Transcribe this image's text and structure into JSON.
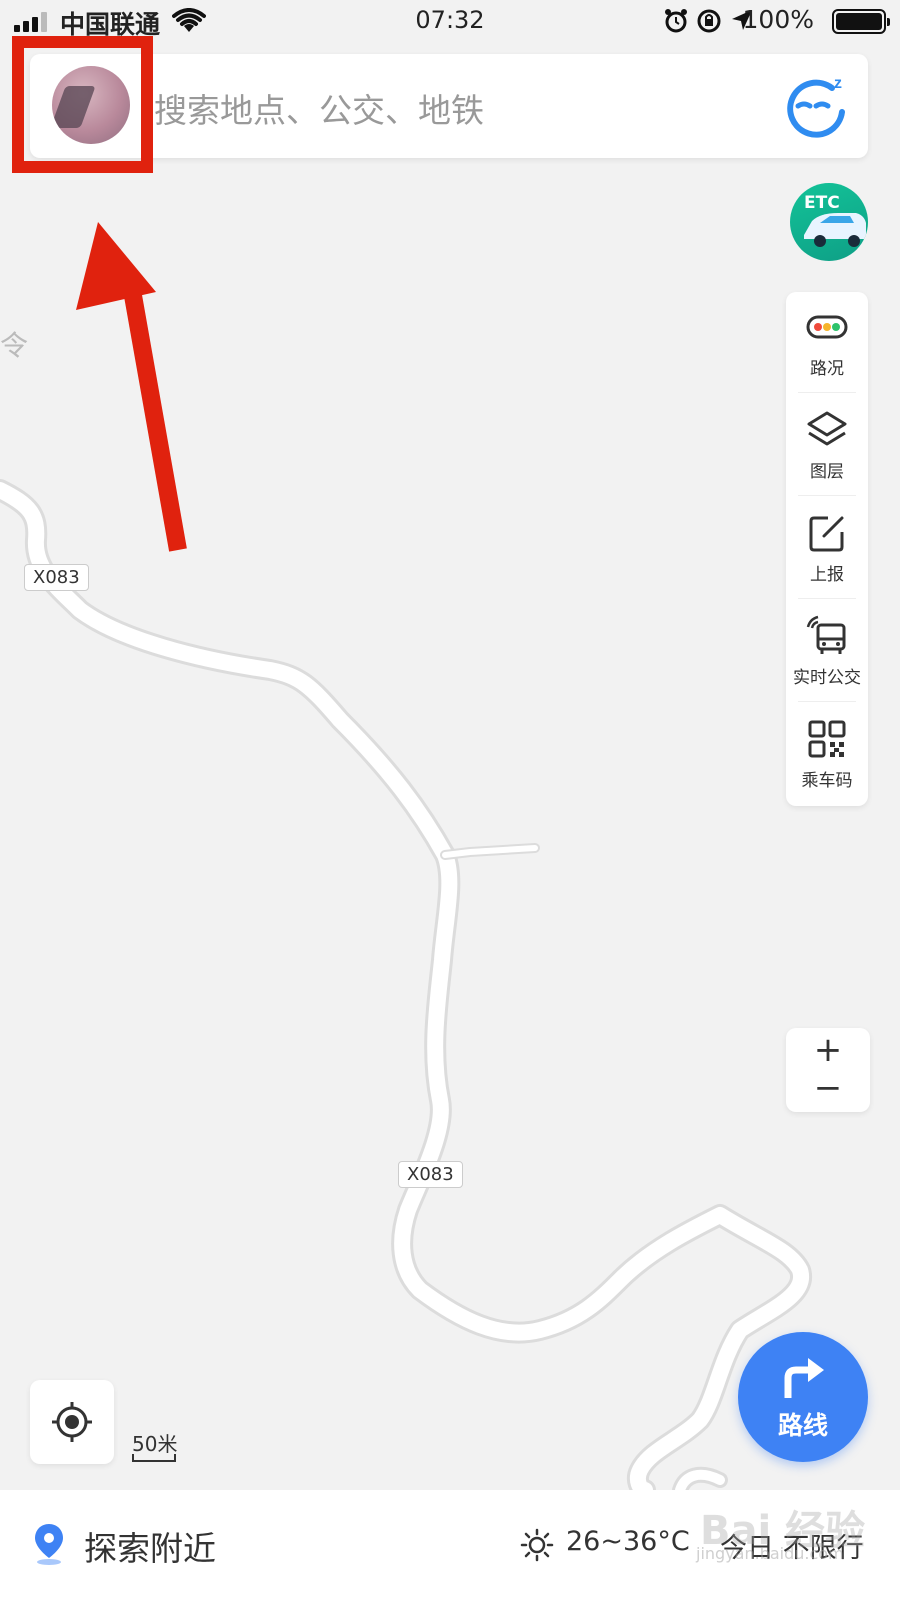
{
  "status_bar": {
    "carrier": "中国联通",
    "time": "07:32",
    "battery": "100%"
  },
  "search": {
    "placeholder": "搜索地点、公交、地铁"
  },
  "etc": {
    "label": "ETC"
  },
  "side_tools": [
    {
      "label": "路况",
      "icon": "traffic-light-icon"
    },
    {
      "label": "图层",
      "icon": "layers-icon"
    },
    {
      "label": "上报",
      "icon": "report-edit-icon"
    },
    {
      "label": "实时公交",
      "icon": "realtime-bus-icon"
    },
    {
      "label": "乘车码",
      "icon": "qr-code-icon"
    }
  ],
  "zoom": {
    "in": "+",
    "out": "−"
  },
  "map": {
    "road_labels": [
      "X083",
      "X083"
    ],
    "edge_text": "令",
    "scale": "50米"
  },
  "route_button": {
    "label": "路线"
  },
  "bottom_bar": {
    "explore": "探索附近",
    "weather": "26~36°C",
    "traffic_limit": "今日 不限行"
  },
  "watermark": {
    "main": "Bai 经验",
    "sub": "jingyan.baidu.com"
  },
  "colors": {
    "accent_blue": "#3e82f4",
    "etc_green": "#13c398",
    "annotation_red": "#e0220e"
  }
}
